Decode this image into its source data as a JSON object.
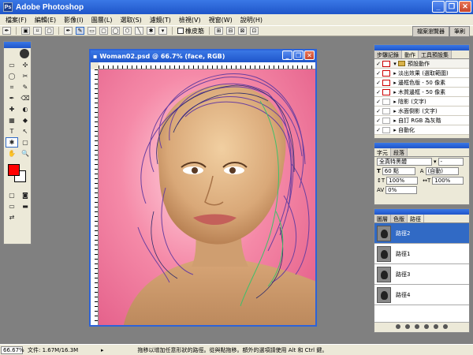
{
  "app": {
    "title": "Adobe Photoshop",
    "icon": "photoshop-logo-icon"
  },
  "menu": [
    "檔案(F)",
    "編輯(E)",
    "影像(I)",
    "圖層(L)",
    "選取(S)",
    "濾鏡(T)",
    "檢視(V)",
    "視窗(W)",
    "說明(H)"
  ],
  "options": {
    "rubber_band_label": "橡皮筋"
  },
  "palette_well": [
    "檔案瀏覽器",
    "筆刷"
  ],
  "toolbox": {
    "tools": [
      "▭",
      "✣",
      "◯",
      "✂",
      "⌗",
      "✎",
      "✒",
      "⌫",
      "✚",
      "◐",
      "▦",
      "◆",
      "T",
      "↖",
      "✱",
      "▢",
      "✋",
      "🔍"
    ],
    "foreground_color": "#ff0000",
    "background_color": "#ffffff"
  },
  "document": {
    "title": "Woman02.psd @ 66.7% (face, RGB)"
  },
  "actions_panel": {
    "tabs": [
      "步驟記錄",
      "動作",
      "工具預設集"
    ],
    "items": [
      {
        "label": "預設動作",
        "folder": true
      },
      {
        "label": "淡出效果 (選取範圍)"
      },
      {
        "label": "邊框色版 - 50 像素"
      },
      {
        "label": "木質邊框 - 50 像素"
      },
      {
        "label": "陰影 (文字)"
      },
      {
        "label": "水面倒影 (文字)"
      },
      {
        "label": "自訂 RGB 為灰階"
      },
      {
        "label": "自動化"
      }
    ]
  },
  "character_panel": {
    "tabs": [
      "字元",
      "段落"
    ],
    "font_family": "全真特黑體",
    "font_style": "-",
    "size": "60 點",
    "leading": "(自動)",
    "vscale": "100%",
    "hscale": "100%",
    "tracking": "0%"
  },
  "paths_panel": {
    "tabs": [
      "圖層",
      "色版",
      "路徑"
    ],
    "paths": [
      "路徑2",
      "路徑1",
      "路徑3",
      "路徑4"
    ],
    "selected_index": 0
  },
  "status": {
    "zoom": "66.67%",
    "doc_size": "文件: 1.67M/16.3M",
    "hint": "拖移以增加任意形狀的路徑。從與點拖移。額外的選項請使用 Alt 和 Ctrl 鍵。"
  }
}
